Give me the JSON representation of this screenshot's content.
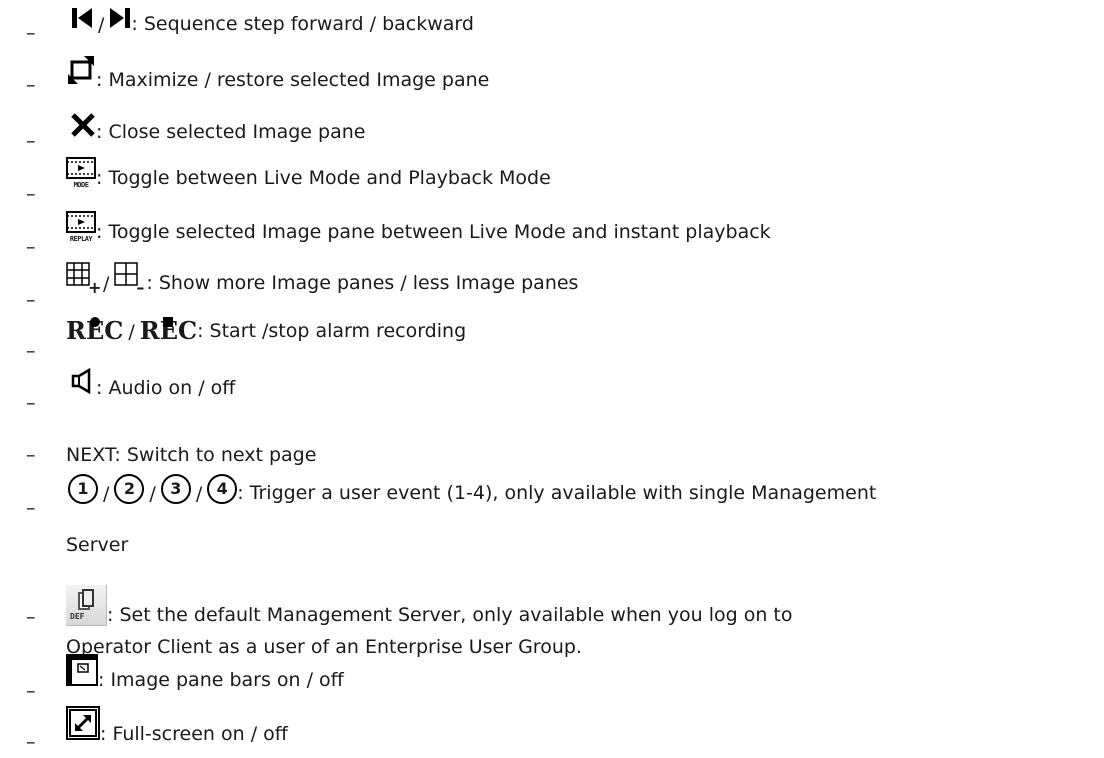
{
  "list": {
    "bullet": "–",
    "items": [
      {
        "text": ": Sequence step forward / backward",
        "sep": "/"
      },
      {
        "text": ": Maximize / restore selected Image pane"
      },
      {
        "text": ": Close selected Image pane"
      },
      {
        "text": ": Toggle between Live Mode and Playback Mode",
        "icon_label": "MODE"
      },
      {
        "text": ": Toggle selected Image pane between Live Mode and instant playback",
        "icon_label": "REPLAY"
      },
      {
        "text": ": Show more Image panes / less Image panes",
        "sep": "/",
        "plus": "+",
        "minus": "–"
      },
      {
        "text": ": Start /stop alarm recording",
        "rec_label": "REC",
        "sep": "/"
      },
      {
        "text": ": Audio on / off"
      },
      {
        "text": "NEXT: Switch to next page"
      },
      {
        "text": ": Trigger a user event (1-4), only available with single Management",
        "continuation": "Server",
        "numbers": [
          "1",
          "2",
          "3",
          "4"
        ],
        "sep": "/"
      },
      {
        "text": ": Set the default Management Server, only available when you log on to",
        "continuation": "Operator Client as a user of an Enterprise User Group.",
        "icon_label": "DEF"
      },
      {
        "text": ": Image pane bars on / off"
      },
      {
        "text": ": Full-screen on / off"
      }
    ]
  }
}
